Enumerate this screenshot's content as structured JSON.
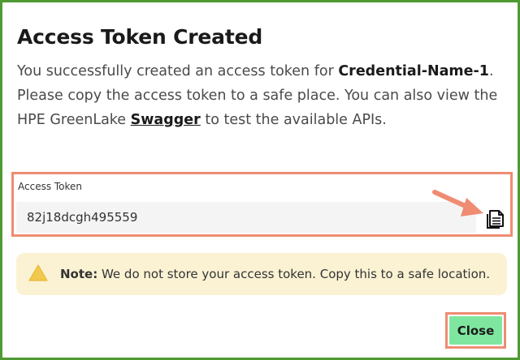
{
  "dialog": {
    "title": "Access Token Created",
    "description": {
      "intro": "You successfully created an access token for ",
      "credential_name": "Credential-Name-1",
      "middle": ". Please copy the access token to a safe place. You can also view the HPE GreenLake ",
      "link_label": "Swagger",
      "outro": " to test the available APIs."
    },
    "token": {
      "label": "Access Token",
      "value": "82j18dcgh495559",
      "copy_icon": "copy-icon"
    },
    "note": {
      "icon": "warning-icon",
      "label": "Note:",
      "text": " We do not store your access token. Copy this to a safe location."
    },
    "close_label": "Close"
  },
  "colors": {
    "frame_border": "#4f9a32",
    "highlight": "#ef8c72",
    "note_background": "#fbf2d3",
    "warning_icon": "#f2c94c",
    "close_button": "#7fe6a0"
  }
}
